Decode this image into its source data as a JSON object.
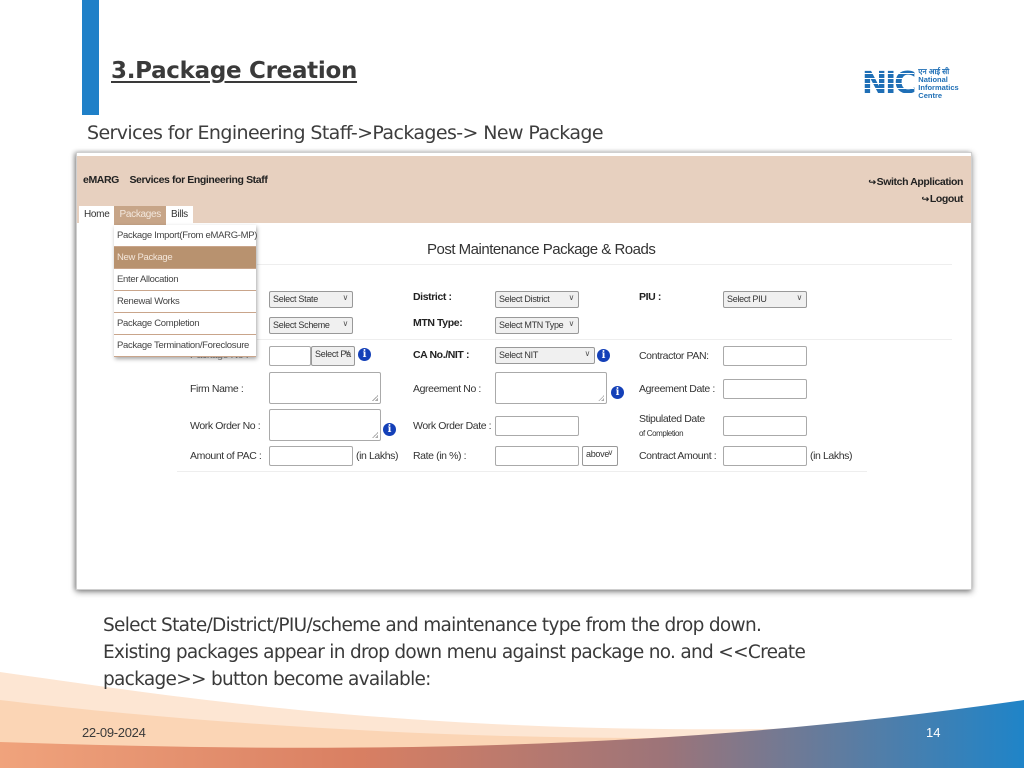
{
  "slide": {
    "title": "3.Package Creation",
    "breadcrumb": "Services for Engineering Staff->Packages-> New Package",
    "logo": {
      "mark": "NIC",
      "hindi": "एन आई सी",
      "line1": "National",
      "line2": "Informatics",
      "line3": "Centre"
    },
    "description": [
      "Select  State/District/PIU/scheme and maintenance type from the drop down.",
      "Existing packages appear in drop down menu against package no. and <<Create",
      "package>> button become available:"
    ],
    "footer": {
      "date": "22-09-2024",
      "page": "14"
    },
    "colors": {
      "accent": "#1f80c8",
      "header_bg": "#e7d0bf",
      "active_tab": "#c7a588",
      "info_icon": "#1440b8"
    }
  },
  "app": {
    "brand": "eMARG",
    "module": "Services for Engineering Staff",
    "switch_application": "Switch Application",
    "logout": "Logout",
    "tabs": [
      {
        "label": "Home",
        "active": false
      },
      {
        "label": "Packages",
        "active": true
      },
      {
        "label": "Bills",
        "active": false
      }
    ],
    "packages_menu": [
      {
        "label": "Package Import(From eMARG-MP)",
        "active": false
      },
      {
        "label": "New Package",
        "active": true
      },
      {
        "label": "Enter Allocation",
        "active": false
      },
      {
        "label": "Renewal Works",
        "active": false
      },
      {
        "label": "Package Completion",
        "active": false
      },
      {
        "label": "Package Termination/Foreclosure",
        "active": false
      }
    ],
    "form": {
      "title": "Post Maintenance Package & Roads",
      "state_select": "Select State",
      "scheme_select": "Select Scheme",
      "district_label": "District :",
      "district_select": "Select District",
      "mtn_type_label": "MTN Type:",
      "mtn_type_select": "Select MTN Type",
      "piu_label": "PIU :",
      "piu_select": "Select PIU",
      "package_no_label": "Package No :",
      "package_select": "Select Pa",
      "ca_nit_label": "CA No./NIT :",
      "nit_select": "Select NIT",
      "contractor_pan_label": "Contractor PAN:",
      "firm_name_label": "Firm Name :",
      "agreement_no_label": "Agreement No :",
      "agreement_date_label": "Agreement Date :",
      "work_order_no_label": "Work Order No :",
      "work_order_date_label": "Work Order Date :",
      "stipulated_date_label": "Stipulated Date",
      "stipulated_date_sub": "of Completion",
      "amount_pac_label": "Amount of PAC :",
      "amount_pac_unit": "(in Lakhs)",
      "rate_label": "Rate (in %) :",
      "rate_select": "above",
      "contract_amount_label": "Contract Amount :",
      "contract_amount_unit": "(in Lakhs)"
    }
  }
}
